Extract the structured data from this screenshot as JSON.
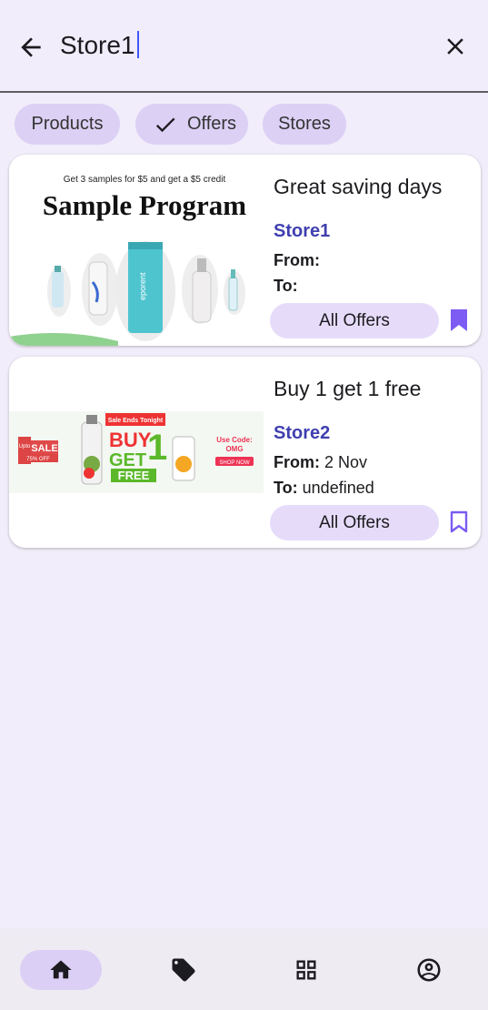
{
  "search": {
    "query": "Store1"
  },
  "chips": [
    {
      "label": "Products",
      "selected": false
    },
    {
      "label": "Offers",
      "selected": true
    },
    {
      "label": "Stores",
      "selected": false
    }
  ],
  "offers": [
    {
      "title": "Great saving days",
      "store": "Store1",
      "from_label": "From:",
      "from_value": "",
      "to_label": "To:",
      "to_value": "",
      "button": "All Offers",
      "bookmarked": true,
      "banner": {
        "tagline": "Get 3 samples for $5 and get a $5 credit",
        "headline": "Sample Program",
        "product_brand": "eporent"
      }
    },
    {
      "title": "Buy 1 get 1 free",
      "store": "Store2",
      "from_label": "From:",
      "from_value": " 2  Nov",
      "to_label": "To:",
      "to_value": " undefined",
      "button": "All Offers",
      "bookmarked": false,
      "banner": {
        "ribbon": "Sale Ends Tonight",
        "promo_top": "BUY",
        "promo_number": "1",
        "promo_mid": "GET",
        "promo_bottom": "FREE",
        "code_label": "Use Code:",
        "code_value": "OMG",
        "cta": "SHOP NOW",
        "sale": "SALE",
        "side_small": "Upto",
        "side_small2": "75% OFF"
      }
    }
  ],
  "colors": {
    "background": "#f1edfa",
    "accent": "#7c5cf2",
    "chip": "#dcd0f5",
    "store_link": "#3f3fb0",
    "nav_active": "#dccff5"
  },
  "nav": {
    "items": [
      {
        "icon": "home-icon",
        "active": true
      },
      {
        "icon": "tag-icon",
        "active": false
      },
      {
        "icon": "grid-icon",
        "active": false
      },
      {
        "icon": "account-icon",
        "active": false
      }
    ]
  }
}
